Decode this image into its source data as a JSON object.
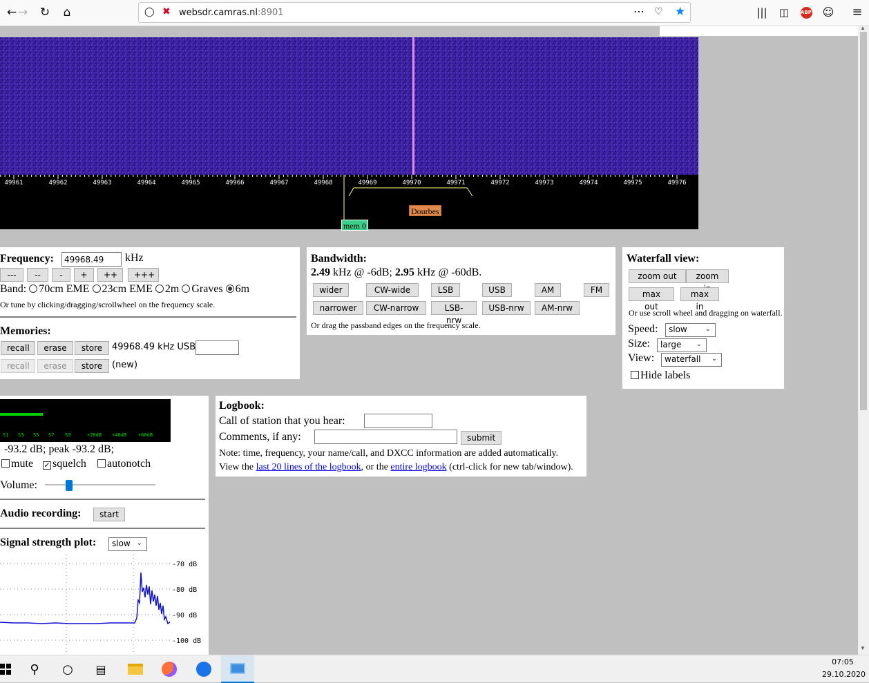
{
  "browser": {
    "url_host": "websdr.camras.nl",
    "url_port": ":8901"
  },
  "waterfall": {
    "tick_labels": [
      "49961",
      "49962",
      "49963",
      "49964",
      "49965",
      "49966",
      "49967",
      "49968",
      "49969",
      "49970",
      "49971",
      "49972",
      "49973",
      "49974",
      "49975",
      "49976"
    ],
    "station_label": "Dourbes",
    "memory_label": "mem 0",
    "bg_color": "#3a1fa0",
    "signal_color": "#ff9fff"
  },
  "frequency_panel": {
    "heading": "Frequency:",
    "value": "49968.49",
    "unit": "kHz",
    "step_buttons": [
      "---",
      "--",
      "-",
      "+",
      "++",
      "+++"
    ],
    "band_label": "Band:",
    "bands": [
      {
        "label": "70cm EME",
        "selected": false
      },
      {
        "label": "23cm EME",
        "selected": false
      },
      {
        "label": "2m",
        "selected": false
      },
      {
        "label": "Graves",
        "selected": false
      },
      {
        "label": "6m",
        "selected": true
      }
    ],
    "tune_hint": "Or tune by clicking/dragging/scrollwheel on the frequency scale.",
    "memories_heading": "Memories:",
    "mem_row1": {
      "recall": "recall",
      "erase": "erase",
      "store": "store",
      "info": "49968.49 kHz USB"
    },
    "mem_row2": {
      "recall": "recall",
      "erase": "erase",
      "store": "store",
      "info": "(new)"
    }
  },
  "bandwidth_panel": {
    "heading": "Bandwidth:",
    "value1": "2.49",
    "text1": " kHz @ -6dB; ",
    "value2": "2.95",
    "text2": " kHz @ -60dB.",
    "row1": [
      "wider",
      "CW-wide",
      "LSB",
      "USB",
      "AM",
      "FM"
    ],
    "row2": [
      "narrower",
      "CW-narrow",
      "LSB-nrw",
      "USB-nrw",
      "AM-nrw"
    ],
    "hint": "Or drag the passband edges on the frequency scale."
  },
  "waterfall_view_panel": {
    "heading": "Waterfall view:",
    "zoom_out": "zoom out",
    "zoom_in": "zoom in",
    "max_out": "max out",
    "max_in": "max in",
    "hint": "Or use scroll wheel and dragging on waterfall.",
    "speed_label": "Speed:",
    "speed_value": "slow",
    "size_label": "Size:",
    "size_value": "large",
    "view_label": "View:",
    "view_value": "waterfall",
    "hide_labels": "Hide labels"
  },
  "audio_panel": {
    "smeter_labels": [
      "S1",
      "S3",
      "S5",
      "S7",
      "S9",
      "+20dB",
      "+40dB",
      "+60dB"
    ],
    "smeter_level": 0.25,
    "readout": "-93.2 dB; peak   -93.2 dB;",
    "mute": "mute",
    "squelch": "squelch",
    "autonotch": "autonotch",
    "volume_label": "Volume:",
    "volume_level": 0.2,
    "recording_heading": "Audio recording:",
    "recording_button": "start",
    "plot_heading": "Signal strength plot:",
    "plot_speed": "slow",
    "plot_axis": [
      "-70 dB",
      "-80 dB",
      "-90 dB",
      "-100 dB"
    ]
  },
  "logbook_panel": {
    "heading": "Logbook:",
    "call_label": "Call of station that you hear:",
    "comments_label": "Comments, if any:",
    "submit": "submit",
    "note": "Note: time, frequency, your name/call, and DXCC information are added automatically.",
    "view_prefix": "View the ",
    "link1": "last 20 lines of the logbook",
    "mid": ", or the ",
    "link2": "entire logbook",
    "suffix": " (ctrl-click for new tab/window)."
  },
  "taskbar": {
    "time": "07:05",
    "date": "29.10.2020"
  }
}
